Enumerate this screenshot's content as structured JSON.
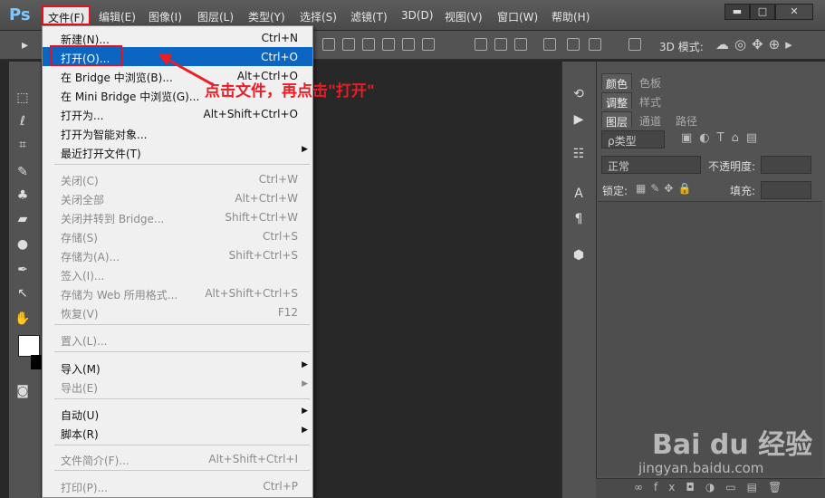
{
  "app": {
    "logo": "Ps"
  },
  "menubar": {
    "items": [
      "文件(F)",
      "编辑(E)",
      "图像(I)",
      "图层(L)",
      "类型(Y)",
      "选择(S)",
      "滤镜(T)",
      "3D(D)",
      "视图(V)",
      "窗口(W)",
      "帮助(H)"
    ]
  },
  "window": {
    "min": "▬",
    "max": "□",
    "close": "✕"
  },
  "options": {
    "mode_label": "3D 模式:"
  },
  "file_menu": {
    "new": {
      "label": "新建(N)...",
      "shortcut": "Ctrl+N"
    },
    "open": {
      "label": "打开(O)...",
      "shortcut": "Ctrl+O"
    },
    "bridge": {
      "label": "在 Bridge 中浏览(B)...",
      "shortcut": "Alt+Ctrl+O"
    },
    "mini_bridge": {
      "label": "在 Mini Bridge 中浏览(G)..."
    },
    "open_as": {
      "label": "打开为...",
      "shortcut": "Alt+Shift+Ctrl+O"
    },
    "open_smart": {
      "label": "打开为智能对象..."
    },
    "recent": {
      "label": "最近打开文件(T)"
    },
    "close": {
      "label": "关闭(C)",
      "shortcut": "Ctrl+W"
    },
    "close_all": {
      "label": "关闭全部",
      "shortcut": "Alt+Ctrl+W"
    },
    "close_bridge": {
      "label": "关闭并转到 Bridge...",
      "shortcut": "Shift+Ctrl+W"
    },
    "save": {
      "label": "存储(S)",
      "shortcut": "Ctrl+S"
    },
    "save_as": {
      "label": "存储为(A)...",
      "shortcut": "Shift+Ctrl+S"
    },
    "checkin": {
      "label": "签入(I)..."
    },
    "save_web": {
      "label": "存储为 Web 所用格式...",
      "shortcut": "Alt+Shift+Ctrl+S"
    },
    "revert": {
      "label": "恢复(V)",
      "shortcut": "F12"
    },
    "place": {
      "label": "置入(L)..."
    },
    "import": {
      "label": "导入(M)"
    },
    "export": {
      "label": "导出(E)"
    },
    "automate": {
      "label": "自动(U)"
    },
    "scripts": {
      "label": "脚本(R)"
    },
    "file_info": {
      "label": "文件简介(F)...",
      "shortcut": "Alt+Shift+Ctrl+I"
    },
    "print": {
      "label": "打印(P)...",
      "shortcut": "Ctrl+P"
    }
  },
  "annotation": {
    "text": "点击文件，再点击\"打开\""
  },
  "panels": {
    "tabs1": [
      "颜色",
      "色板"
    ],
    "tabs2": [
      "调整",
      "样式"
    ],
    "tabs3": [
      "图层",
      "通道",
      "路径"
    ],
    "filter_kind": "ρ类型",
    "blend_mode": "正常",
    "opacity_label": "不透明度:",
    "lock_label": "锁定:",
    "fill_label": "填充:"
  },
  "watermark": {
    "brand": "Bai du 经验",
    "url": "jingyan.baidu.com"
  },
  "colors": {
    "highlight": "#0a66c2",
    "annotation": "#ee1a24"
  }
}
